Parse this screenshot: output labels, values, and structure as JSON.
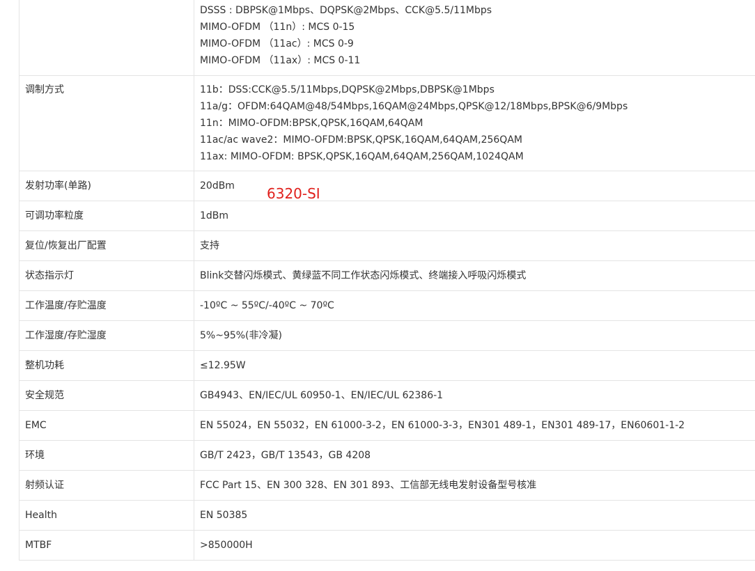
{
  "rows": [
    {
      "label": "",
      "values": [
        "DSSS : DBPSK@1Mbps、DQPSK@2Mbps、CCK@5.5/11Mbps",
        "MIMO-OFDM （11n）: MCS 0-15",
        "MIMO-OFDM （11ac）: MCS 0-9",
        "MIMO-OFDM （11ax）: MCS 0-11"
      ]
    },
    {
      "label": "调制方式",
      "values": [
        "11b：DSS:CCK@5.5/11Mbps,DQPSK@2Mbps,DBPSK@1Mbps",
        "11a/g：OFDM:64QAM@48/54Mbps,16QAM@24Mbps,QPSK@12/18Mbps,BPSK@6/9Mbps",
        "11n：MIMO-OFDM:BPSK,QPSK,16QAM,64QAM",
        "11ac/ac wave2：MIMO-OFDM:BPSK,QPSK,16QAM,64QAM,256QAM",
        "11ax: MIMO-OFDM: BPSK,QPSK,16QAM,64QAM,256QAM,1024QAM"
      ]
    },
    {
      "label": "发射功率(单路)",
      "values": [
        "20dBm"
      ]
    },
    {
      "label": "可调功率粒度",
      "values": [
        "1dBm"
      ]
    },
    {
      "label": "复位/恢复出厂配置",
      "values": [
        "支持"
      ]
    },
    {
      "label": "状态指示灯",
      "values": [
        "Blink交替闪烁模式、黄绿蓝不同工作状态闪烁模式、终端接入呼吸闪烁模式"
      ]
    },
    {
      "label": "工作温度/存贮温度",
      "values": [
        "-10ºC ~ 55ºC/-40ºC ~ 70ºC"
      ]
    },
    {
      "label": "工作湿度/存贮湿度",
      "values": [
        "5%~95%(非冷凝)"
      ]
    },
    {
      "label": "整机功耗",
      "values": [
        "≤12.95W"
      ]
    },
    {
      "label": "安全规范",
      "values": [
        "GB4943、EN/IEC/UL 60950-1、EN/IEC/UL 62386-1"
      ]
    },
    {
      "label": "EMC",
      "values": [
        "EN 55024，EN 55032，EN 61000-3-2，EN 61000-3-3，EN301 489-1，EN301 489-17，EN60601-1-2"
      ]
    },
    {
      "label": "环境",
      "values": [
        "GB/T 2423，GB/T 13543，GB 4208"
      ]
    },
    {
      "label": "射频认证",
      "values": [
        "FCC Part 15、EN 300 328、EN 301 893、工信部无线电发射设备型号核准"
      ]
    },
    {
      "label": "Health",
      "values": [
        "EN 50385"
      ]
    },
    {
      "label": "MTBF",
      "values": [
        ">850000H"
      ]
    }
  ],
  "annotation": "6320-SI"
}
